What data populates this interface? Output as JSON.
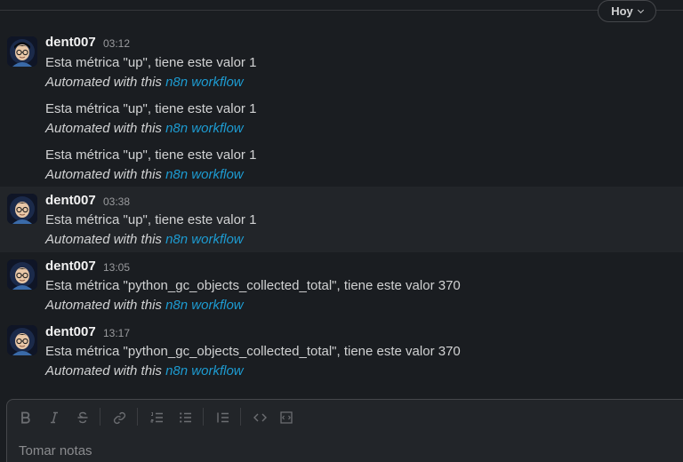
{
  "divider": {
    "date_label": "Hoy"
  },
  "link_text": "n8n workflow",
  "automated_prefix": "Automated with this ",
  "groups": [
    {
      "sender": "dent007",
      "time": "03:12",
      "messages": [
        "Esta métrica \"up\", tiene este valor  1",
        "Esta métrica \"up\", tiene este valor  1",
        "Esta métrica \"up\", tiene este valor  1"
      ]
    },
    {
      "sender": "dent007",
      "time": "03:38",
      "messages": [
        "Esta métrica \"up\", tiene este valor  1"
      ]
    },
    {
      "sender": "dent007",
      "time": "13:05",
      "messages": [
        "Esta métrica \"python_gc_objects_collected_total\", tiene este valor  370"
      ]
    },
    {
      "sender": "dent007",
      "time": "13:17",
      "messages": [
        "Esta métrica \"python_gc_objects_collected_total\", tiene este valor  370"
      ]
    }
  ],
  "composer": {
    "placeholder": "Tomar notas",
    "toolbar_icons": [
      "bold-icon",
      "italic-icon",
      "strikethrough-icon",
      "link-icon",
      "ordered-list-icon",
      "bulleted-list-icon",
      "blockquote-icon",
      "code-icon",
      "code-block-icon"
    ]
  },
  "colors": {
    "background": "#1a1d21",
    "highlight": "#222529",
    "link": "#1d9bd1"
  }
}
